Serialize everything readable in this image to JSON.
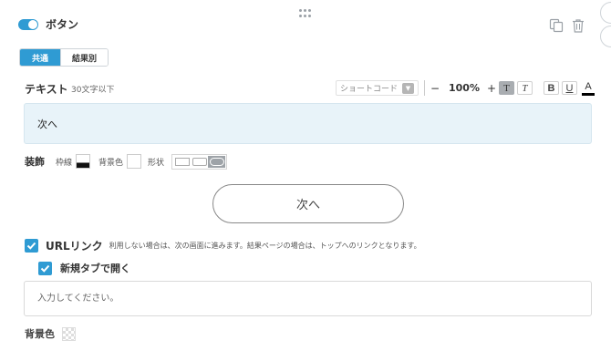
{
  "header": {
    "title": "ボタン",
    "toggle_on": true,
    "icons": [
      "copy-icon",
      "trash-icon"
    ]
  },
  "tabs": [
    {
      "label": "共通",
      "active": true
    },
    {
      "label": "結果別",
      "active": false
    }
  ],
  "text_section": {
    "label": "テキスト",
    "hint": "30文字以下",
    "value": "次へ"
  },
  "toolbar": {
    "shortcode_label": "ショートコード",
    "minus": "−",
    "zoom": "100%",
    "plus": "+",
    "t_normal": "T",
    "t_italic": "T",
    "bold": "B",
    "underline": "U",
    "color": "A"
  },
  "decoration": {
    "title": "装飾",
    "border_label": "枠線",
    "bg_label": "背景色",
    "shape_label": "形状",
    "shapes": [
      "square",
      "rounded",
      "pill"
    ],
    "selected_shape": "pill"
  },
  "preview": {
    "button_text": "次へ"
  },
  "url_link": {
    "checked": true,
    "label": "URLリンク",
    "hint": "利用しない場合は、次の画面に進みます。結果ページの場合は、トップへのリンクとなります。"
  },
  "new_tab": {
    "checked": true,
    "label": "新規タブで開く"
  },
  "url_input": {
    "placeholder": "入力してください。",
    "value": ""
  },
  "background": {
    "label": "背景色"
  },
  "colors": {
    "accent": "#2f9bd3",
    "input_bg": "#e8f3f9"
  }
}
